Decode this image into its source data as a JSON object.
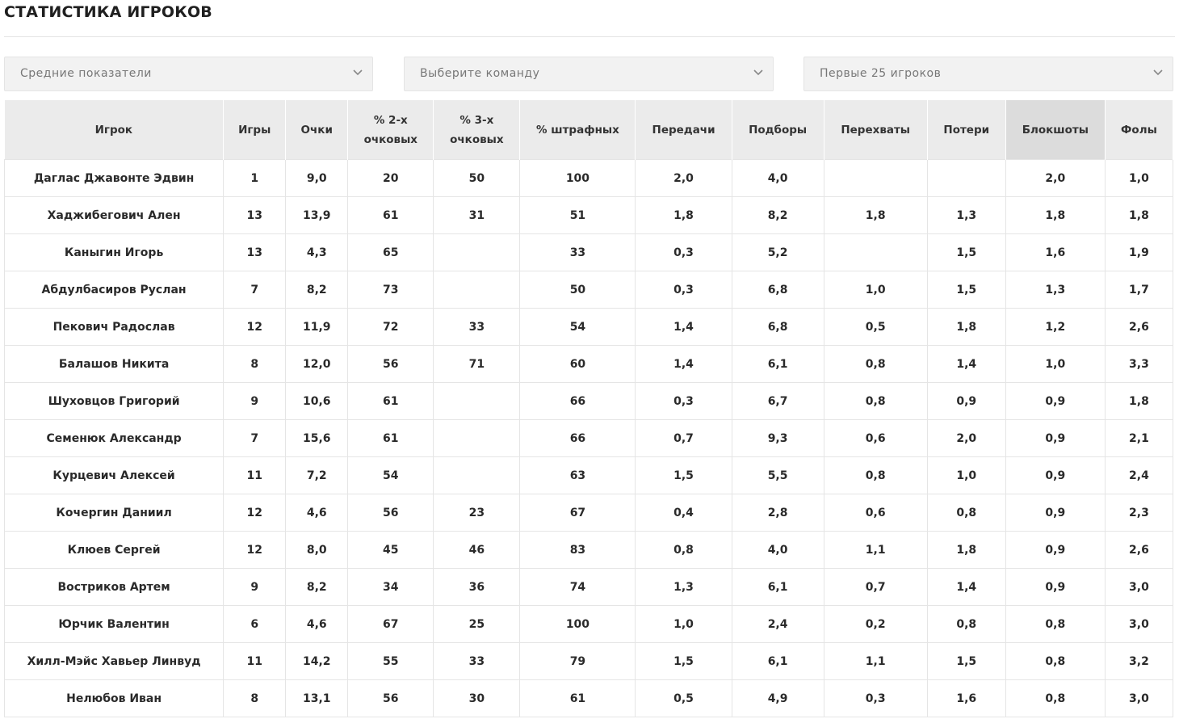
{
  "title": "СТАТИСТИКА ИГРОКОВ",
  "filters": {
    "mode": "Средние показатели",
    "team": "Выберите команду",
    "players": "Первые 25 игроков"
  },
  "columns": [
    "Игрок",
    "Игры",
    "Очки",
    "% 2-х очковых",
    "% 3-х очковых",
    "% штрафных",
    "Передачи",
    "Подборы",
    "Перехваты",
    "Потери",
    "Блокшоты",
    "Фолы"
  ],
  "sorted_column": "Блокшоты",
  "colors": {
    "header_bg": "#ebebeb",
    "sorted_header_bg": "#dcdcdc",
    "select_bg": "#f2f2f2"
  },
  "rows": [
    [
      "Даглас Джавонте Эдвин",
      "1",
      "9,0",
      "20",
      "50",
      "100",
      "2,0",
      "4,0",
      "",
      "",
      "2,0",
      "1,0"
    ],
    [
      "Хаджибегович Ален",
      "13",
      "13,9",
      "61",
      "31",
      "51",
      "1,8",
      "8,2",
      "1,8",
      "1,3",
      "1,8",
      "1,8"
    ],
    [
      "Каныгин Игорь",
      "13",
      "4,3",
      "65",
      "",
      "33",
      "0,3",
      "5,2",
      "",
      "1,5",
      "1,6",
      "1,9"
    ],
    [
      "Абдулбасиров Руслан",
      "7",
      "8,2",
      "73",
      "",
      "50",
      "0,3",
      "6,8",
      "1,0",
      "1,5",
      "1,3",
      "1,7"
    ],
    [
      "Пекович Радослав",
      "12",
      "11,9",
      "72",
      "33",
      "54",
      "1,4",
      "6,8",
      "0,5",
      "1,8",
      "1,2",
      "2,6"
    ],
    [
      "Балашов Никита",
      "8",
      "12,0",
      "56",
      "71",
      "60",
      "1,4",
      "6,1",
      "0,8",
      "1,4",
      "1,0",
      "3,3"
    ],
    [
      "Шуховцов Григорий",
      "9",
      "10,6",
      "61",
      "",
      "66",
      "0,3",
      "6,7",
      "0,8",
      "0,9",
      "0,9",
      "1,8"
    ],
    [
      "Семенюк Александр",
      "7",
      "15,6",
      "61",
      "",
      "66",
      "0,7",
      "9,3",
      "0,6",
      "2,0",
      "0,9",
      "2,1"
    ],
    [
      "Курцевич Алексей",
      "11",
      "7,2",
      "54",
      "",
      "63",
      "1,5",
      "5,5",
      "0,8",
      "1,0",
      "0,9",
      "2,4"
    ],
    [
      "Кочергин Даниил",
      "12",
      "4,6",
      "56",
      "23",
      "67",
      "0,4",
      "2,8",
      "0,6",
      "0,8",
      "0,9",
      "2,3"
    ],
    [
      "Клюев Сергей",
      "12",
      "8,0",
      "45",
      "46",
      "83",
      "0,8",
      "4,0",
      "1,1",
      "1,8",
      "0,9",
      "2,6"
    ],
    [
      "Востриков Артем",
      "9",
      "8,2",
      "34",
      "36",
      "74",
      "1,3",
      "6,1",
      "0,7",
      "1,4",
      "0,9",
      "3,0"
    ],
    [
      "Юрчик Валентин",
      "6",
      "4,6",
      "67",
      "25",
      "100",
      "1,0",
      "2,4",
      "0,2",
      "0,8",
      "0,8",
      "3,0"
    ],
    [
      "Хилл-Мэйс Хавьер Линвуд",
      "11",
      "14,2",
      "55",
      "33",
      "79",
      "1,5",
      "6,1",
      "1,1",
      "1,5",
      "0,8",
      "3,2"
    ],
    [
      "Нелюбов Иван",
      "8",
      "13,1",
      "56",
      "30",
      "61",
      "0,5",
      "4,9",
      "0,3",
      "1,6",
      "0,8",
      "3,0"
    ]
  ]
}
